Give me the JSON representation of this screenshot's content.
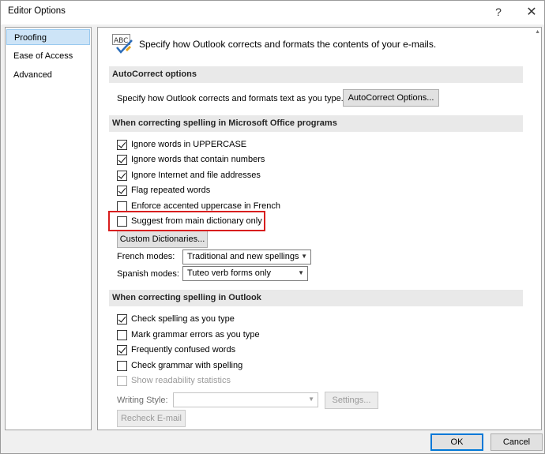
{
  "window": {
    "title": "Editor Options",
    "help_glyph": "?",
    "close_glyph": "✕"
  },
  "nav": {
    "items": [
      "Proofing",
      "Ease of Access",
      "Advanced"
    ]
  },
  "intro": {
    "text": "Specify how Outlook corrects and formats the contents of your e-mails.",
    "icon_text": "ABC"
  },
  "autocorrect": {
    "heading": "AutoCorrect options",
    "description": "Specify how Outlook corrects and formats text as you type.",
    "button_label": "AutoCorrect Options..."
  },
  "office_spelling": {
    "heading": "When correcting spelling in Microsoft Office programs",
    "options": [
      {
        "label": "Ignore words in UPPERCASE",
        "checked": true
      },
      {
        "label": "Ignore words that contain numbers",
        "checked": true
      },
      {
        "label": "Ignore Internet and file addresses",
        "checked": true
      },
      {
        "label": "Flag repeated words",
        "checked": true
      },
      {
        "label": "Enforce accented uppercase in French",
        "checked": false
      },
      {
        "label": "Suggest from main dictionary only",
        "checked": false
      }
    ],
    "custom_dictionaries_label": "Custom Dictionaries...",
    "french_modes_label": "French modes:",
    "french_modes_value": "Traditional and new spellings",
    "spanish_modes_label": "Spanish modes:",
    "spanish_modes_value": "Tuteo verb forms only"
  },
  "outlook_spelling": {
    "heading": "When correcting spelling in Outlook",
    "options": [
      {
        "label": "Check spelling as you type",
        "checked": true
      },
      {
        "label": "Mark grammar errors as you type",
        "checked": false
      },
      {
        "label": "Frequently confused words",
        "checked": true
      },
      {
        "label": "Check grammar with spelling",
        "checked": false
      },
      {
        "label": "Show readability statistics",
        "checked": false,
        "disabled": true
      }
    ],
    "writing_style_label": "Writing Style:",
    "writing_style_value": "",
    "settings_label": "Settings...",
    "recheck_label": "Recheck E-mail"
  },
  "footer": {
    "ok_label": "OK",
    "cancel_label": "Cancel"
  },
  "colors": {
    "accent": "#0078d7",
    "highlight_box": "#d81e1e",
    "nav_selected": "#cde4f7"
  }
}
